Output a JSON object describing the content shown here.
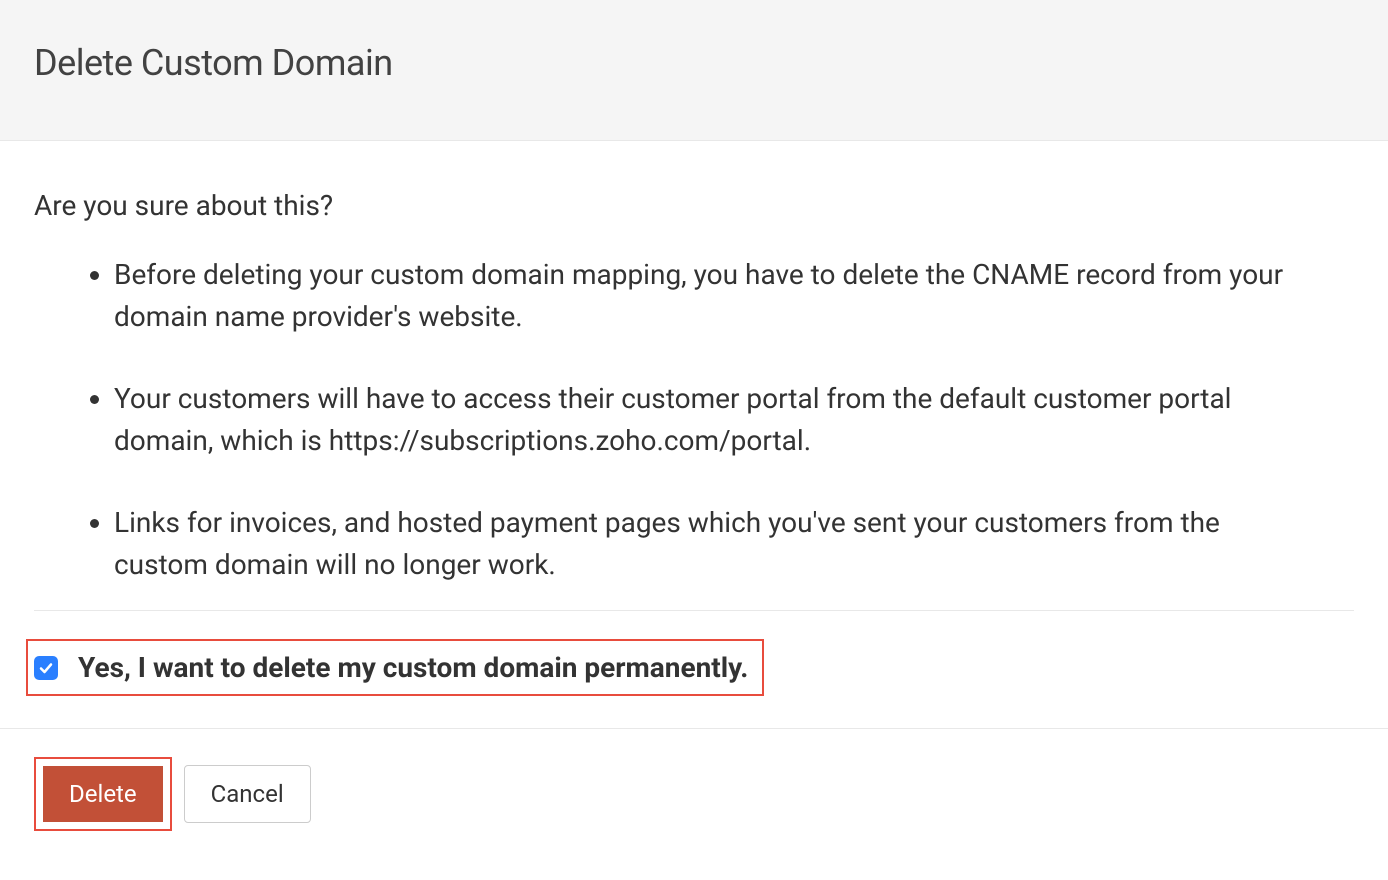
{
  "header": {
    "title": "Delete Custom Domain"
  },
  "body": {
    "question": "Are you sure about this?",
    "points": [
      "Before deleting your custom domain mapping, you have to delete the CNAME record from your domain name provider's website.",
      "Your customers will have to access their customer portal from the default customer portal domain, which is https://subscriptions.zoho.com/portal.",
      "Links for invoices, and hosted payment pages which you've sent your customers from the custom domain will no longer work."
    ],
    "confirm_label": "Yes, I want to delete my custom domain permanently.",
    "confirm_checked": true
  },
  "footer": {
    "delete_label": "Delete",
    "cancel_label": "Cancel"
  },
  "colors": {
    "highlight_border": "#e84c3d",
    "delete_bg": "#c25037",
    "checkbox_bg": "#2a7fff"
  }
}
